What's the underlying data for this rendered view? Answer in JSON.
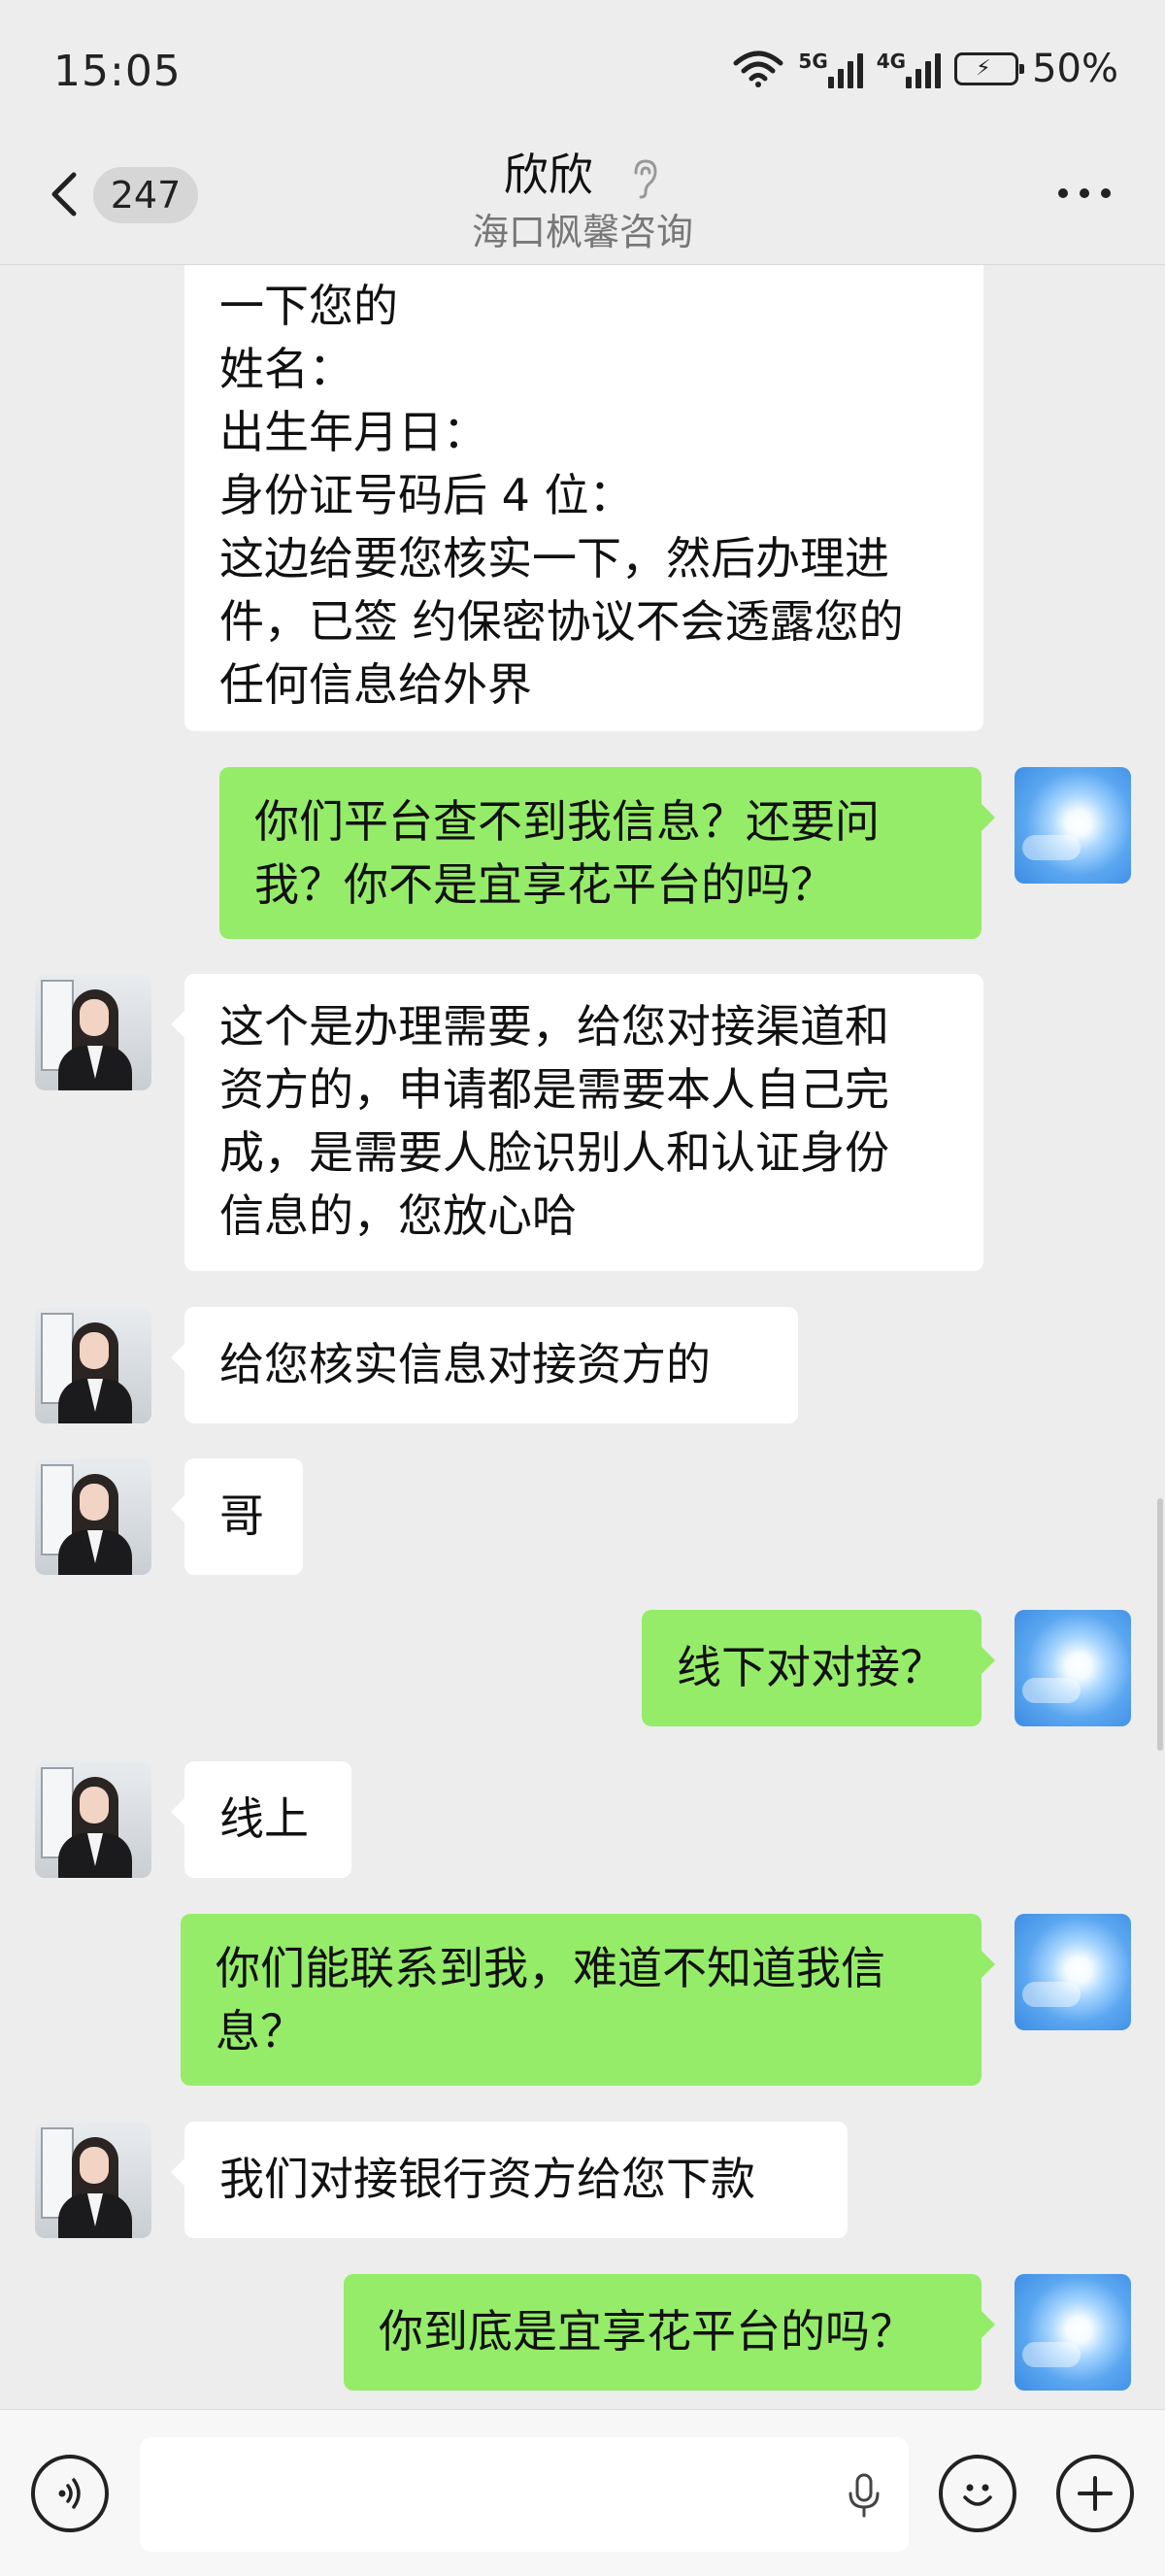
{
  "status_bar": {
    "time": "15:05",
    "network_1": "5G",
    "network_2": "4G",
    "battery": "50%"
  },
  "header": {
    "back_icon": "chevron-left-icon",
    "unread_count": "247",
    "title": "欣欣",
    "subtitle": "海口枫馨咨询",
    "ear_icon": "earpiece-mode-icon",
    "more_icon": "more-dots-icon"
  },
  "messages": [
    {
      "from": "agent",
      "lines": [
        "一下您的",
        "姓名：",
        "出生年月日：",
        "身份证号码后 4 位：",
        "这边给要您核实一下，然后办理进",
        "件，已签 约保密协议不会透露您的",
        "任何信息给外界"
      ]
    },
    {
      "from": "me",
      "lines": [
        "你们平台查不到我信息？还要问",
        "我？你不是宜享花平台的吗？"
      ]
    },
    {
      "from": "agent",
      "lines": [
        " 这个是办理需要，给您对接渠道和",
        "资方的，申请都是需要本人自己完",
        "成，是需要人脸识别人和认证身份",
        "信息的，您放心哈"
      ]
    },
    {
      "from": "agent",
      "lines": [
        "给您核实信息对接资方的"
      ]
    },
    {
      "from": "agent",
      "lines": [
        "哥"
      ]
    },
    {
      "from": "me",
      "lines": [
        "线下对对接？"
      ]
    },
    {
      "from": "agent",
      "lines": [
        "线上"
      ]
    },
    {
      "from": "me",
      "lines": [
        "你们能联系到我，难道不知道我信",
        "息？"
      ]
    },
    {
      "from": "agent",
      "lines": [
        "我们对接银行资方给您下款"
      ]
    },
    {
      "from": "me",
      "lines": [
        "你到底是宜享花平台的吗？"
      ]
    }
  ],
  "input_bar": {
    "voice_icon": "voice-mode-icon",
    "mic_icon": "microphone-icon",
    "emoji_icon": "emoji-icon",
    "plus_icon": "plus-icon",
    "text_value": ""
  }
}
